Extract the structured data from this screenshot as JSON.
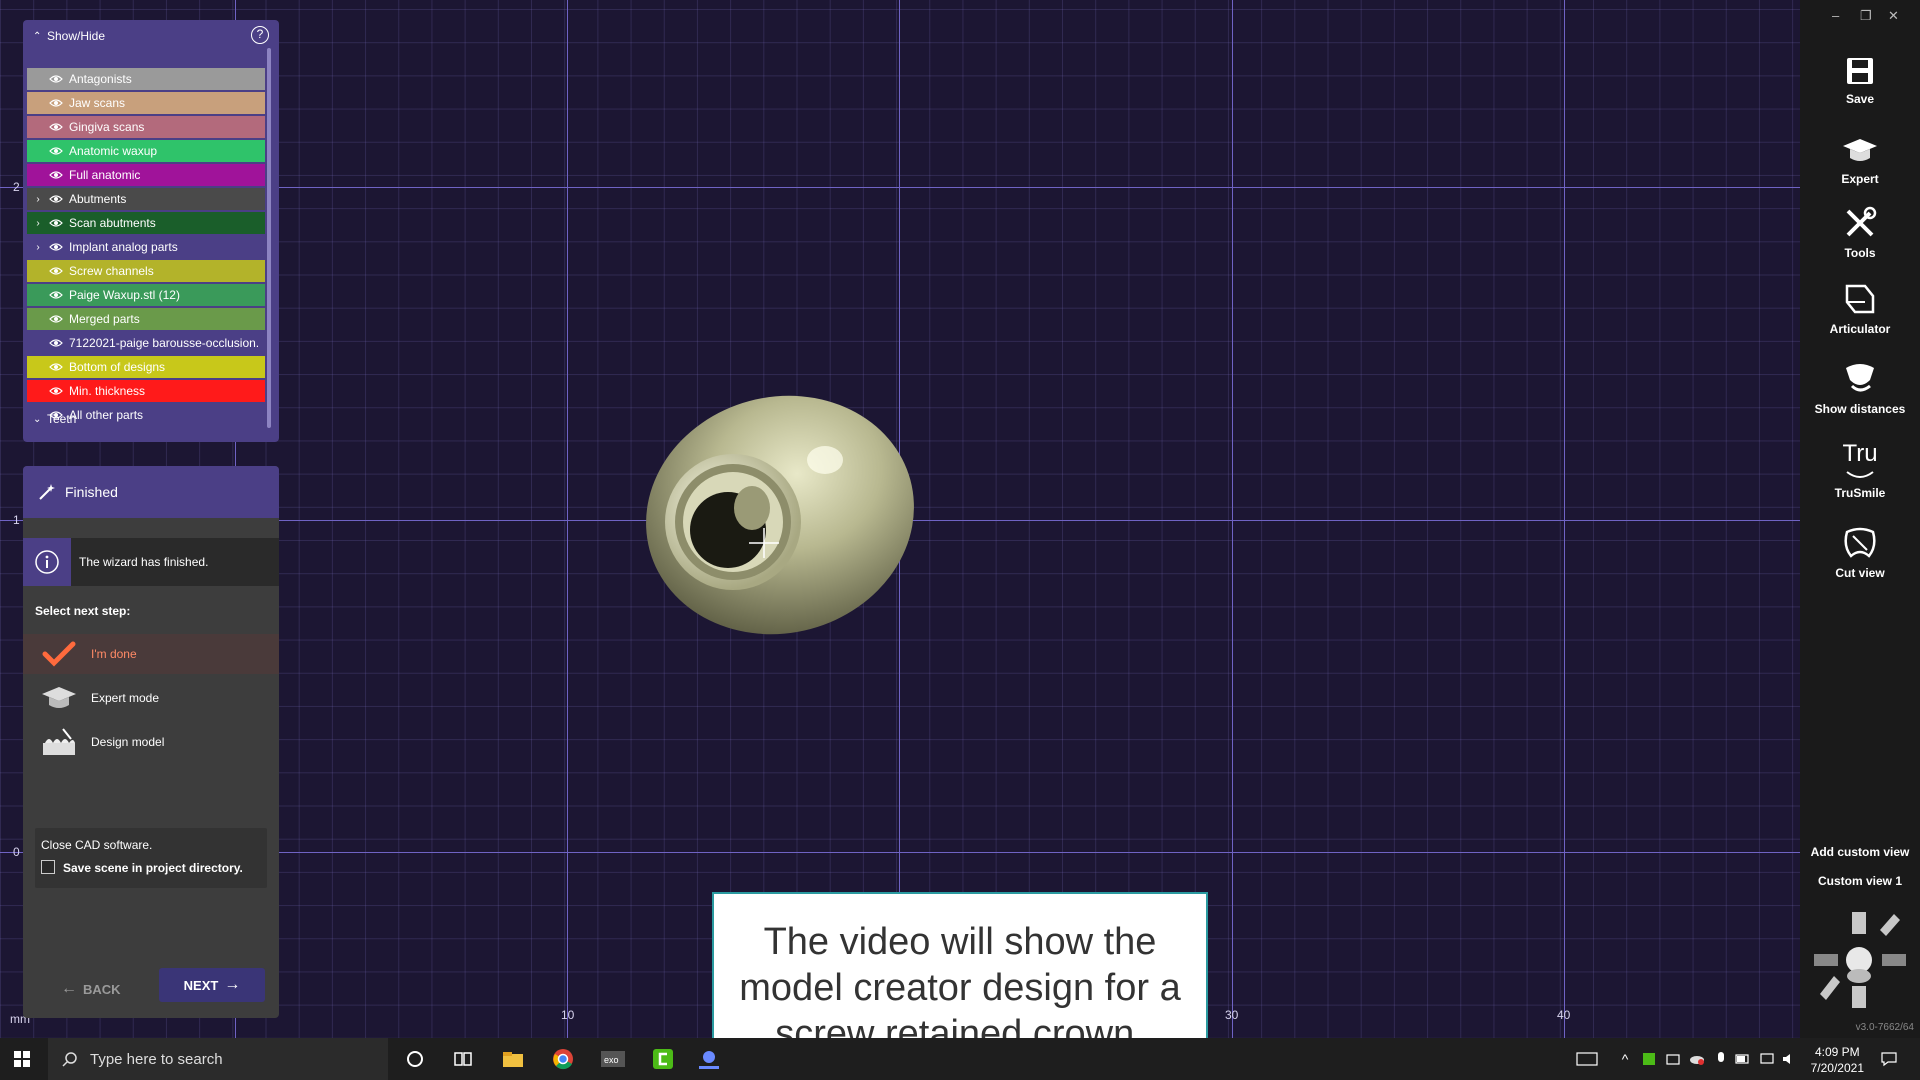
{
  "show_hide": {
    "title": "Show/Hide",
    "layers": [
      {
        "label": "Antagonists",
        "color": "#9a9a9a",
        "expandable": false
      },
      {
        "label": "Jaw scans",
        "color": "#c8a07c",
        "expandable": false
      },
      {
        "label": "Gingiva scans",
        "color": "#b36a7c",
        "expandable": false
      },
      {
        "label": "Anatomic waxup",
        "color": "#2fc36a",
        "expandable": false
      },
      {
        "label": "Full anatomic",
        "color": "#a0139a",
        "expandable": false
      },
      {
        "label": "Abutments",
        "color": "#4a4a4a",
        "expandable": true
      },
      {
        "label": "Scan abutments",
        "color": "#1a5e2a",
        "expandable": true
      },
      {
        "label": "Implant analog parts",
        "color": "#4b3f86",
        "expandable": true
      },
      {
        "label": "Screw channels",
        "color": "#b3b32a",
        "expandable": false
      },
      {
        "label": "Paige Waxup.stl (12)",
        "color": "#3a9a5a",
        "expandable": false
      },
      {
        "label": "Merged parts",
        "color": "#6a9a4a",
        "expandable": false
      },
      {
        "label": "7122021-paige barousse-occlusion.",
        "color": "#4b3f86",
        "expandable": false
      },
      {
        "label": "Bottom of designs",
        "color": "#c8c81a",
        "expandable": false
      },
      {
        "label": "Min. thickness",
        "color": "#ff1a1a",
        "expandable": false
      },
      {
        "label": "All other parts",
        "color": "#4b3f86",
        "expandable": false
      }
    ],
    "teeth_label": "Teeth"
  },
  "wizard": {
    "title": "Finished",
    "info_text": "The wizard has finished.",
    "select_label": "Select next step:",
    "options": [
      {
        "label": "I'm done"
      },
      {
        "label": "Expert mode"
      },
      {
        "label": "Design model"
      }
    ],
    "close_title": "Close CAD software.",
    "save_label": "Save scene in project directory.",
    "back_label": "BACK",
    "next_label": "NEXT"
  },
  "toolbar": {
    "tools": [
      {
        "label": "Save",
        "icon": "save-icon"
      },
      {
        "label": "Expert",
        "icon": "graduation-cap-icon"
      },
      {
        "label": "Tools",
        "icon": "tools-icon"
      },
      {
        "label": "Articulator",
        "icon": "articulator-icon"
      },
      {
        "label": "Show distances",
        "icon": "distances-icon"
      },
      {
        "label": "TruSmile",
        "icon": "trusmile-icon"
      },
      {
        "label": "Cut view",
        "icon": "cut-view-icon"
      }
    ],
    "add_custom_view": "Add custom view",
    "custom_view_1": "Custom view 1",
    "trusmile_glyph": "Tru",
    "version": "v3.0-7662/64"
  },
  "viewport": {
    "axis_x_labels": [
      "10",
      "30",
      "40"
    ],
    "axis_y_labels": [
      "2",
      "1",
      "0"
    ],
    "unit": "mm"
  },
  "caption": {
    "text": "The video will show the model creator design for a screw retained crown."
  },
  "taskbar": {
    "search_placeholder": "Type here to search",
    "time": "4:09 PM",
    "date": "7/20/2021"
  }
}
